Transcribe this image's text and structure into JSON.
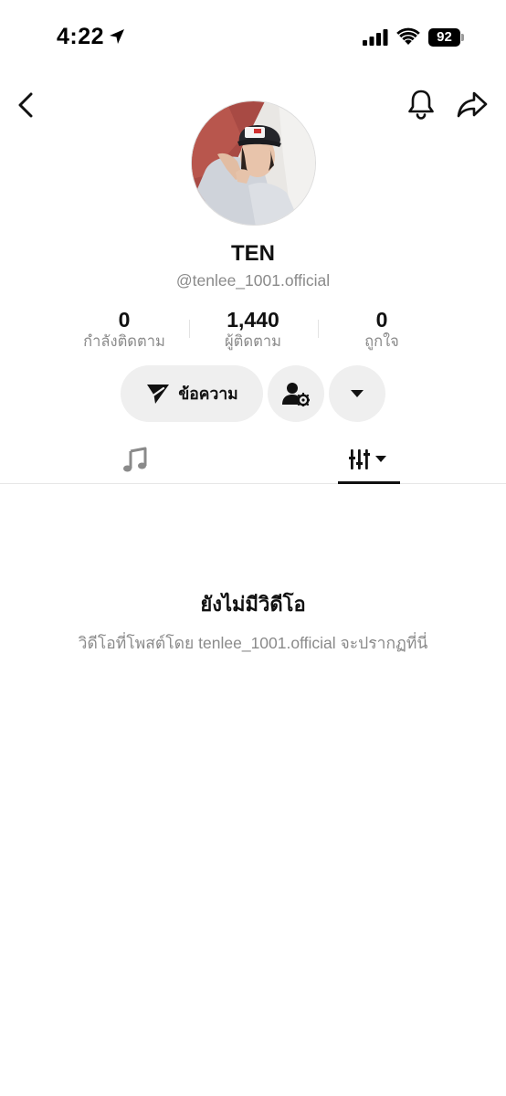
{
  "status_bar": {
    "time": "4:22",
    "battery": "92"
  },
  "icons": {
    "location": "location-arrow-icon",
    "signal": "cellular-signal-icon",
    "wifi": "wifi-icon",
    "back": "chevron-left-icon",
    "bell": "bell-icon",
    "share": "share-arrow-icon",
    "message": "send-plane-icon",
    "friend_settings": "person-gear-icon",
    "dropdown": "caret-down-icon",
    "music": "music-note-icon",
    "filter": "filter-bars-icon"
  },
  "profile": {
    "display_name": "TEN",
    "username": "@tenlee_1001.official"
  },
  "stats": [
    {
      "value": "0",
      "label": "กำลังติดตาม"
    },
    {
      "value": "1,440",
      "label": "ผู้ติดตาม"
    },
    {
      "value": "0",
      "label": "ถูกใจ"
    }
  ],
  "actions": {
    "message_label": "ข้อความ"
  },
  "empty_state": {
    "title": "ยังไม่มีวิดีโอ",
    "description": "วิดีโอที่โพสต์โดย tenlee_1001.official จะปรากฏที่นี่"
  },
  "colors": {
    "text_primary": "#111111",
    "text_secondary": "#8a8a8a",
    "button_bg": "#efefef"
  }
}
